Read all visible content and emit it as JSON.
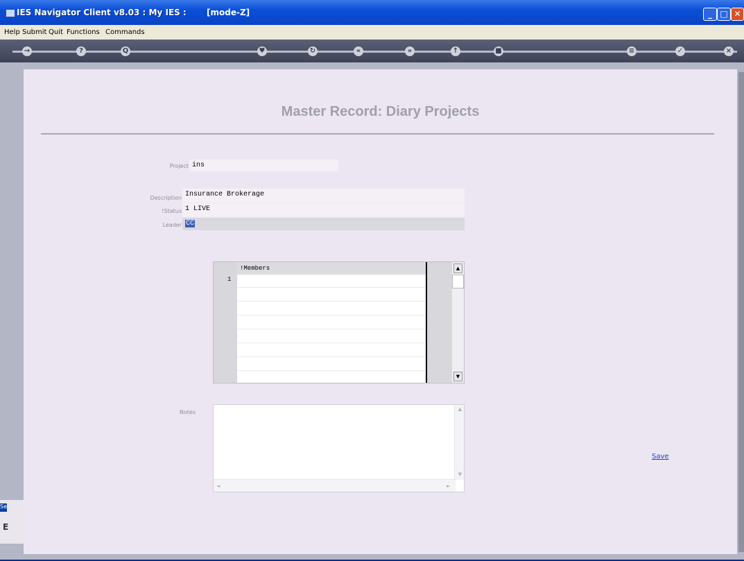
{
  "window": {
    "title": "IES Navigator Client v8.03 : My IES :",
    "mode": "[mode-Z]",
    "controls": [
      "minimize-icon",
      "maximize-icon",
      "close-icon"
    ]
  },
  "menu": {
    "items": [
      "Help",
      "Submit",
      "Quit",
      "Functions",
      "Commands"
    ]
  },
  "toolbar": {
    "buttons": [
      {
        "icon": "arrow-icon",
        "glyph": "→"
      },
      {
        "icon": "help-icon",
        "glyph": "?"
      },
      {
        "icon": "search-icon",
        "glyph": "Q"
      },
      {
        "icon": "heart-icon",
        "glyph": "♥"
      },
      {
        "icon": "refresh-icon",
        "glyph": "↻"
      },
      {
        "icon": "back-icon",
        "glyph": "«"
      },
      {
        "icon": "forward-icon",
        "glyph": "»"
      },
      {
        "icon": "up-icon",
        "glyph": "↑"
      },
      {
        "icon": "stop-icon",
        "glyph": "■"
      },
      {
        "icon": "menu-icon",
        "glyph": "≡"
      },
      {
        "icon": "check-icon",
        "glyph": "✓"
      },
      {
        "icon": "close-icon",
        "glyph": "×"
      }
    ]
  },
  "page": {
    "title": "Master Record: Diary Projects"
  },
  "form": {
    "project_label": "Project",
    "project_value": "ins",
    "description_label": "Description",
    "description_value": "Insurance Brokerage",
    "status_label": "!Status",
    "status_value": "1 LIVE",
    "leader_label": "Leader",
    "leader_value": "CC"
  },
  "members_grid": {
    "header": "!Members",
    "rows": [
      "1"
    ]
  },
  "notes": {
    "label": "Notes"
  },
  "actions": {
    "save_label": "Save"
  },
  "side": {
    "label": "Se",
    "letter": "E"
  }
}
